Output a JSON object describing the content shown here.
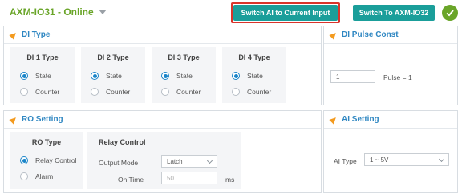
{
  "header": {
    "device_title": "AXM-IO31 - Online",
    "switch_ai_label": "Switch AI to Current Input",
    "switch_io32_label": "Switch To AXM-IO32"
  },
  "di_type": {
    "title": "DI Type",
    "cards": [
      {
        "title": "DI 1 Type",
        "options": [
          "State",
          "Counter"
        ],
        "selected": "State"
      },
      {
        "title": "DI 2 Type",
        "options": [
          "State",
          "Counter"
        ],
        "selected": "State"
      },
      {
        "title": "DI 3 Type",
        "options": [
          "State",
          "Counter"
        ],
        "selected": "State"
      },
      {
        "title": "DI 4 Type",
        "options": [
          "State",
          "Counter"
        ],
        "selected": "State"
      }
    ]
  },
  "di_pulse_const": {
    "title": "DI Pulse Const",
    "value": "1",
    "formula": "Pulse = 1"
  },
  "ro_setting": {
    "title": "RO Setting",
    "ro_type": {
      "title": "RO Type",
      "options": [
        "Relay Control",
        "Alarm"
      ],
      "selected": "Relay Control"
    },
    "relay_control": {
      "title": "Relay Control",
      "output_mode_label": "Output Mode",
      "output_mode_value": "Latch",
      "on_time_label": "On Time",
      "on_time_value": "50",
      "on_time_unit": "ms"
    }
  },
  "ai_setting": {
    "title": "AI Setting",
    "ai_type_label": "AI Type",
    "ai_type_value": "1 ~ 5V"
  },
  "colors": {
    "accent_teal": "#1a9e9a",
    "online_green": "#6aa529",
    "section_blue": "#2f87c2",
    "section_marker_orange": "#f39a1e",
    "highlight_red": "#d9342b",
    "radio_blue": "#1a84c8"
  }
}
